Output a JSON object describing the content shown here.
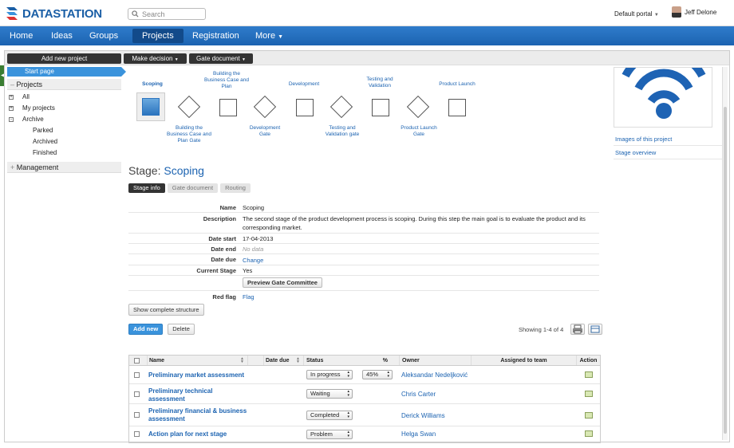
{
  "header": {
    "logo": "DATASTATION",
    "search_placeholder": "Search",
    "portal": "Default portal",
    "user": "Jeff Delone"
  },
  "nav": [
    "Home",
    "Ideas",
    "Groups",
    "Projects",
    "Registration",
    "More"
  ],
  "toolbar": {
    "add_project": "Add new project",
    "make_decision": "Make decision",
    "gate_document": "Gate document"
  },
  "sidebar": {
    "start_page": "Start page",
    "projects": "Projects",
    "items": [
      "All",
      "My projects",
      "Archive"
    ],
    "archive_items": [
      "Parked",
      "Archived",
      "Finished"
    ],
    "management": "Management"
  },
  "process": {
    "top": [
      "Scoping",
      "Building the Business Case and Plan",
      "Development",
      "Testing and Validation",
      "Product Launch"
    ],
    "bottom": [
      "Building the Business Case and Plan Gate",
      "Development Gate",
      "Testing and Validation gate",
      "Product Launch Gate"
    ]
  },
  "stage": {
    "prefix": "Stage:",
    "name": "Scoping",
    "tabs": [
      "Stage info",
      "Gate document",
      "Routing"
    ]
  },
  "info": {
    "name_label": "Name",
    "name": "Scoping",
    "desc_label": "Description",
    "desc": "The second stage of the product development process is scoping. During this step the main goal is to evaluate the product and its corresponding market.",
    "start_label": "Date start",
    "start": "17-04-2013",
    "end_label": "Date end",
    "end": "No data",
    "due_label": "Date due",
    "due": "Change",
    "current_label": "Current Stage",
    "current": "Yes",
    "preview_btn": "Preview Gate Committee",
    "flag_label": "Red flag",
    "flag": "Flag",
    "structure_btn": "Show complete structure"
  },
  "tasks": {
    "add_btn": "Add new",
    "delete_btn": "Delete",
    "showing": "Showing 1-4 of 4",
    "columns": [
      "Name",
      "Date due",
      "Status",
      "%",
      "Owner",
      "Assigned to team",
      "Action"
    ],
    "rows": [
      {
        "name": "Preliminary market assessment",
        "status": "In progress",
        "pct": "45%",
        "owner": "Aleksandar Nedeljković"
      },
      {
        "name": "Preliminary technical assessment",
        "status": "Waiting",
        "pct": "",
        "owner": "Chris Carter"
      },
      {
        "name": "Preliminary financial & business assessment",
        "status": "Completed",
        "pct": "",
        "owner": "Derick Williams"
      },
      {
        "name": "Action plan for next stage",
        "status": "Problem",
        "pct": "",
        "owner": "Helga Swan"
      }
    ]
  },
  "right": {
    "links": [
      "Images of this project",
      "Stage overview"
    ]
  },
  "colors": {
    "accent": "#1c63b1",
    "nav": "#2f7ccb",
    "active": "#3a93dc"
  }
}
